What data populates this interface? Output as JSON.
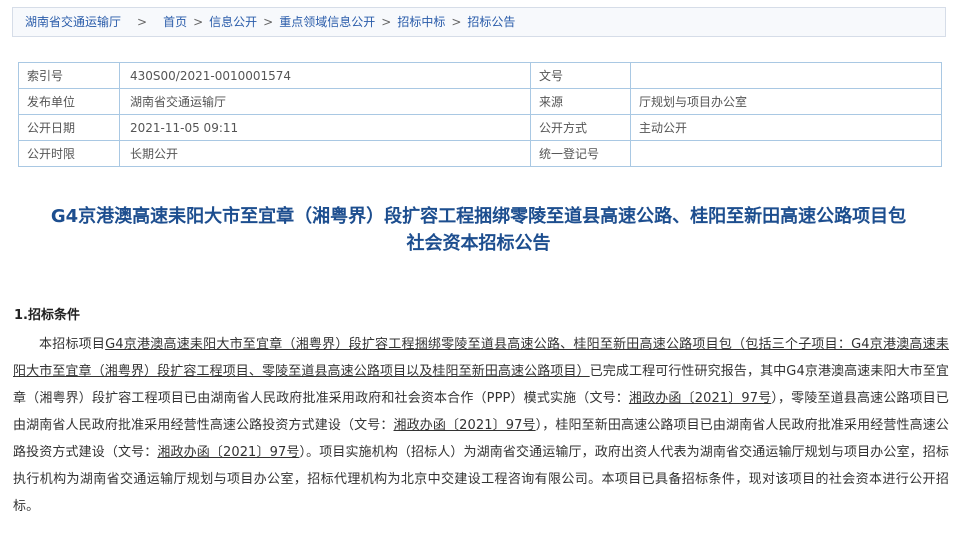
{
  "breadcrumb": {
    "site": "湖南省交通运输厅",
    "sep": ">",
    "path": [
      "首页",
      "信息公开",
      "重点领域信息公开",
      "招标中标",
      "招标公告"
    ]
  },
  "meta": {
    "index_label": "索引号",
    "index_value": "430S00/2021-0010001574",
    "docno_label": "文号",
    "docno_value": "",
    "publisher_label": "发布单位",
    "publisher_value": "湖南省交通运输厅",
    "source_label": "来源",
    "source_value": "厅规划与项目办公室",
    "date_label": "公开日期",
    "date_value": "2021-11-05 09:11",
    "method_label": "公开方式",
    "method_value": "主动公开",
    "period_label": "公开时限",
    "period_value": "长期公开",
    "reg_label": "统一登记号",
    "reg_value": ""
  },
  "title": {
    "line1": "G4京港澳高速耒阳大市至宜章（湘粤界）段扩容工程捆绑零陵至道县高速公路、桂阳至新田高速公路项目包",
    "line2": "社会资本招标公告"
  },
  "section1": {
    "heading": "1.招标条件",
    "p1": "本招标项目",
    "p2_u": "G4京港澳高速耒阳大市至宜章（湘粤界）段扩容工程捆绑零陵至道县高速公路、桂阳至新田高速公路项目包（包括三个子项目：G4京港澳高速耒阳大市至宜章（湘粤界）段扩容工程项目、零陵至道县高速公路项目以及桂阳至新田高速公路项目）",
    "p3": "已完成工程可行性研究报告，其中G4京港澳高速耒阳大市至宜章（湘粤界）段扩容工程项目已由湖南省人民政府批准采用政府和社会资本合作（PPP）模式实施（文号：",
    "p4_u": "湘政办函〔2021〕97号",
    "p5": "），零陵至道县高速公路项目已由湖南省人民政府批准采用经营性高速公路投资方式建设（文号：",
    "p6_u": "湘政办函〔2021〕97号",
    "p7": "），桂阳至新田高速公路项目已由湖南省人民政府批准采用经营性高速公路投资方式建设（文号：",
    "p8_u": "湘政办函〔2021〕97号",
    "p9": "）。项目实施机构（招标人）为湖南省交通运输厅，政府出资人代表为湖南省交通运输厅规划与项目办公室，招标执行机构为湖南省交通运输厅规划与项目办公室，招标代理机构为北京中交建设工程咨询有限公司。本项目已具备招标条件，现对该项目的社会资本进行公开招标。"
  }
}
